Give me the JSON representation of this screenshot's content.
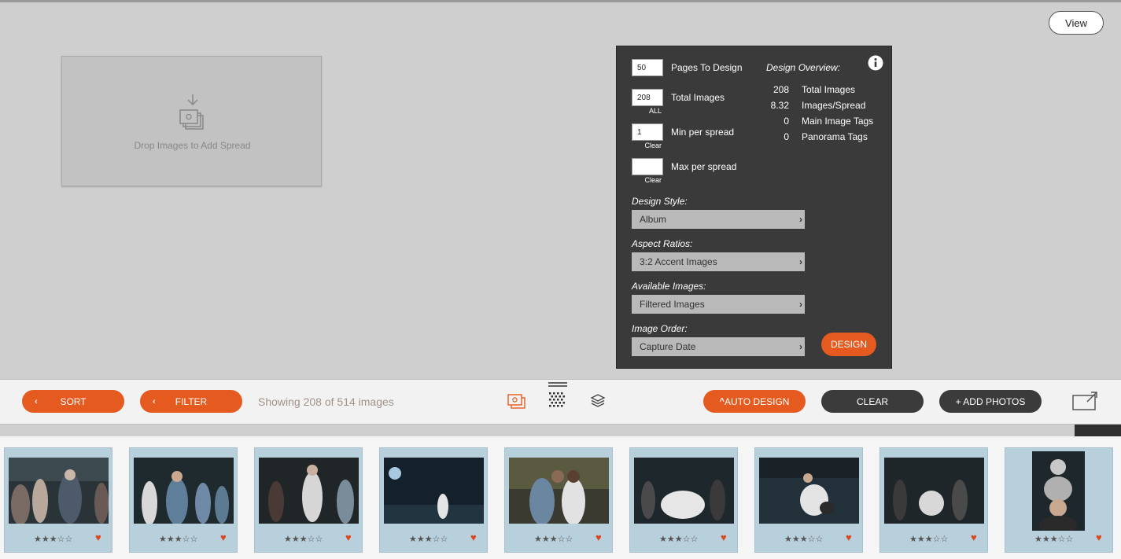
{
  "view_button": "View",
  "dropzone": {
    "text": "Drop Images to Add Spread"
  },
  "panel": {
    "pages_to_design": {
      "value": "50",
      "label": "Pages To Design"
    },
    "total_images": {
      "value": "208",
      "label": "Total Images",
      "sub": "ALL"
    },
    "min_per_spread": {
      "value": "1",
      "label": "Min per spread",
      "sub": "Clear"
    },
    "max_per_spread": {
      "value": "",
      "label": "Max per spread",
      "sub": "Clear"
    },
    "overview_title": "Design Overview:",
    "overview": [
      {
        "value": "208",
        "label": "Total Images"
      },
      {
        "value": "8.32",
        "label": "Images/Spread"
      },
      {
        "value": "0",
        "label": "Main Image Tags"
      },
      {
        "value": "0",
        "label": "Panorama Tags"
      }
    ],
    "design_style": {
      "label": "Design Style:",
      "value": "Album"
    },
    "aspect_ratios": {
      "label": "Aspect Ratios:",
      "value": "3:2 Accent Images"
    },
    "available_images": {
      "label": "Available Images:",
      "value": "Filtered Images"
    },
    "image_order": {
      "label": "Image Order:",
      "value": "Capture Date"
    },
    "design_button": "DESIGN"
  },
  "toolbar": {
    "sort": "SORT",
    "filter": "FILTER",
    "showing": "Showing 208 of 514 images",
    "auto_design": "AUTO DESIGN",
    "clear": "CLEAR",
    "add_photos": "+ ADD PHOTOS",
    "colors": {
      "accent": "#e55a1f",
      "dark": "#3b3b3b"
    }
  },
  "thumbnails": [
    {
      "rating": 3,
      "favorite": true,
      "stars": "★★★☆☆",
      "heart": "♥"
    },
    {
      "rating": 3,
      "favorite": true,
      "stars": "★★★☆☆",
      "heart": "♥"
    },
    {
      "rating": 3,
      "favorite": true,
      "stars": "★★★☆☆",
      "heart": "♥"
    },
    {
      "rating": 3,
      "favorite": true,
      "stars": "★★★☆☆",
      "heart": "♥"
    },
    {
      "rating": 3,
      "favorite": true,
      "stars": "★★★☆☆",
      "heart": "♥"
    },
    {
      "rating": 3,
      "favorite": true,
      "stars": "★★★☆☆",
      "heart": "♥"
    },
    {
      "rating": 3,
      "favorite": true,
      "stars": "★★★☆☆",
      "heart": "♥"
    },
    {
      "rating": 3,
      "favorite": true,
      "stars": "★★★☆☆",
      "heart": "♥"
    },
    {
      "rating": 3,
      "favorite": true,
      "stars": "★★★☆☆",
      "heart": "♥"
    }
  ]
}
